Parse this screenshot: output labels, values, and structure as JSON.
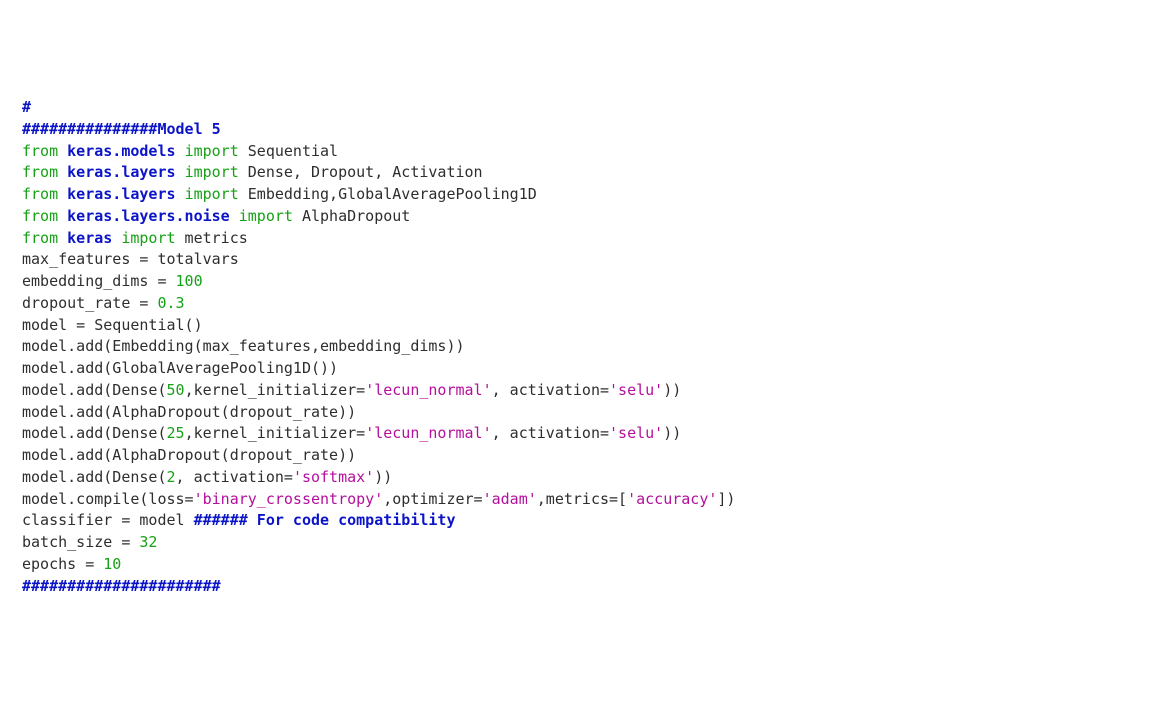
{
  "code": {
    "lines": [
      {
        "spans": [
          {
            "cls": "tok-comment",
            "text": "#"
          }
        ]
      },
      {
        "spans": [
          {
            "cls": "tok-comment",
            "text": "###############Model 5"
          }
        ]
      },
      {
        "spans": [
          {
            "cls": "tok-keyword",
            "text": "from"
          },
          {
            "cls": "tok-default",
            "text": " "
          },
          {
            "cls": "tok-module",
            "text": "keras.models"
          },
          {
            "cls": "tok-default",
            "text": " "
          },
          {
            "cls": "tok-keyword",
            "text": "import"
          },
          {
            "cls": "tok-default",
            "text": " Sequential"
          }
        ]
      },
      {
        "spans": [
          {
            "cls": "tok-keyword",
            "text": "from"
          },
          {
            "cls": "tok-default",
            "text": " "
          },
          {
            "cls": "tok-module",
            "text": "keras.layers"
          },
          {
            "cls": "tok-default",
            "text": " "
          },
          {
            "cls": "tok-keyword",
            "text": "import"
          },
          {
            "cls": "tok-default",
            "text": " Dense, Dropout, Activation"
          }
        ]
      },
      {
        "spans": [
          {
            "cls": "tok-keyword",
            "text": "from"
          },
          {
            "cls": "tok-default",
            "text": " "
          },
          {
            "cls": "tok-module",
            "text": "keras.layers"
          },
          {
            "cls": "tok-default",
            "text": " "
          },
          {
            "cls": "tok-keyword",
            "text": "import"
          },
          {
            "cls": "tok-default",
            "text": " Embedding,GlobalAveragePooling1D"
          }
        ]
      },
      {
        "spans": [
          {
            "cls": "tok-keyword",
            "text": "from"
          },
          {
            "cls": "tok-default",
            "text": " "
          },
          {
            "cls": "tok-module",
            "text": "keras.layers.noise"
          },
          {
            "cls": "tok-default",
            "text": " "
          },
          {
            "cls": "tok-keyword",
            "text": "import"
          },
          {
            "cls": "tok-default",
            "text": " AlphaDropout"
          }
        ]
      },
      {
        "spans": [
          {
            "cls": "tok-keyword",
            "text": "from"
          },
          {
            "cls": "tok-default",
            "text": " "
          },
          {
            "cls": "tok-module",
            "text": "keras"
          },
          {
            "cls": "tok-default",
            "text": " "
          },
          {
            "cls": "tok-keyword",
            "text": "import"
          },
          {
            "cls": "tok-default",
            "text": " metrics"
          }
        ]
      },
      {
        "spans": [
          {
            "cls": "tok-default",
            "text": "max_features = totalvars"
          }
        ]
      },
      {
        "spans": [
          {
            "cls": "tok-default",
            "text": "embedding_dims = "
          },
          {
            "cls": "tok-number",
            "text": "100"
          }
        ]
      },
      {
        "spans": [
          {
            "cls": "tok-default",
            "text": "dropout_rate = "
          },
          {
            "cls": "tok-number",
            "text": "0.3"
          }
        ]
      },
      {
        "spans": [
          {
            "cls": "tok-default",
            "text": "model = Sequential()"
          }
        ]
      },
      {
        "spans": [
          {
            "cls": "tok-default",
            "text": "model.add(Embedding(max_features,embedding_dims))"
          }
        ]
      },
      {
        "spans": [
          {
            "cls": "tok-default",
            "text": "model.add(GlobalAveragePooling1D())"
          }
        ]
      },
      {
        "spans": [
          {
            "cls": "tok-default",
            "text": "model.add(Dense("
          },
          {
            "cls": "tok-number",
            "text": "50"
          },
          {
            "cls": "tok-default",
            "text": ",kernel_initializer="
          },
          {
            "cls": "tok-string",
            "text": "'lecun_normal'"
          },
          {
            "cls": "tok-default",
            "text": ", activation="
          },
          {
            "cls": "tok-string",
            "text": "'selu'"
          },
          {
            "cls": "tok-default",
            "text": "))"
          }
        ]
      },
      {
        "spans": [
          {
            "cls": "tok-default",
            "text": "model.add(AlphaDropout(dropout_rate))"
          }
        ]
      },
      {
        "spans": [
          {
            "cls": "tok-default",
            "text": "model.add(Dense("
          },
          {
            "cls": "tok-number",
            "text": "25"
          },
          {
            "cls": "tok-default",
            "text": ",kernel_initializer="
          },
          {
            "cls": "tok-string",
            "text": "'lecun_normal'"
          },
          {
            "cls": "tok-default",
            "text": ", activation="
          },
          {
            "cls": "tok-string",
            "text": "'selu'"
          },
          {
            "cls": "tok-default",
            "text": "))"
          }
        ]
      },
      {
        "spans": [
          {
            "cls": "tok-default",
            "text": "model.add(AlphaDropout(dropout_rate))"
          }
        ]
      },
      {
        "spans": [
          {
            "cls": "tok-default",
            "text": "model.add(Dense("
          },
          {
            "cls": "tok-number",
            "text": "2"
          },
          {
            "cls": "tok-default",
            "text": ", activation="
          },
          {
            "cls": "tok-string",
            "text": "'softmax'"
          },
          {
            "cls": "tok-default",
            "text": "))"
          }
        ]
      },
      {
        "spans": [
          {
            "cls": "tok-default",
            "text": "model.compile(loss="
          },
          {
            "cls": "tok-string",
            "text": "'binary_crossentropy'"
          },
          {
            "cls": "tok-default",
            "text": ",optimizer="
          },
          {
            "cls": "tok-string",
            "text": "'adam'"
          },
          {
            "cls": "tok-default",
            "text": ",metrics=["
          },
          {
            "cls": "tok-string",
            "text": "'accuracy'"
          },
          {
            "cls": "tok-default",
            "text": "])"
          }
        ]
      },
      {
        "spans": [
          {
            "cls": "tok-default",
            "text": "classifier = model "
          },
          {
            "cls": "tok-comment",
            "text": "###### For code compatibility"
          }
        ]
      },
      {
        "spans": [
          {
            "cls": "tok-default",
            "text": "batch_size = "
          },
          {
            "cls": "tok-number",
            "text": "32"
          }
        ]
      },
      {
        "spans": [
          {
            "cls": "tok-default",
            "text": "epochs = "
          },
          {
            "cls": "tok-number",
            "text": "10"
          }
        ]
      },
      {
        "spans": [
          {
            "cls": "tok-comment",
            "text": "######################"
          }
        ]
      }
    ]
  }
}
